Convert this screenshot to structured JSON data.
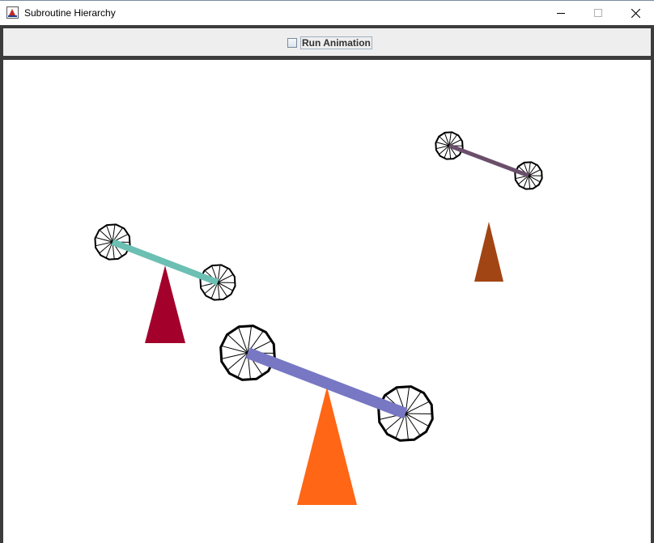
{
  "window": {
    "title": "Subroutine Hierarchy",
    "icon": "java-app-icon",
    "buttons": [
      "minimize",
      "maximize",
      "close"
    ]
  },
  "toolbar": {
    "checkbox_label": "Run Animation",
    "checked": false
  },
  "scene": {
    "seesaws": [
      {
        "name": "seesaw-small",
        "bar_color": "#6a4f6b",
        "base_color": "#a24514"
      },
      {
        "name": "seesaw-medium",
        "bar_color": "#6cbfb3",
        "base_color": "#a3002b"
      },
      {
        "name": "seesaw-large",
        "bar_color": "#7777c4",
        "base_color": "#ff6616"
      }
    ]
  }
}
